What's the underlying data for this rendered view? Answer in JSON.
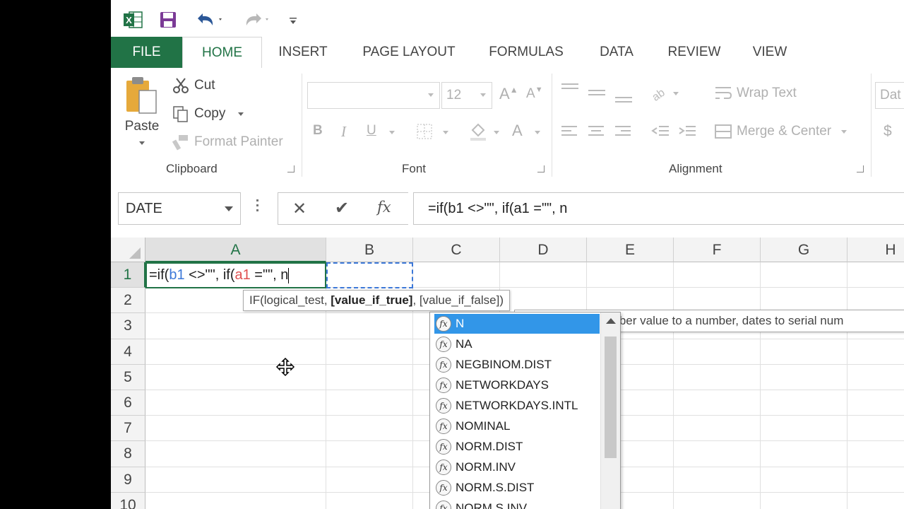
{
  "qat": {
    "app_icon": "excel-logo-icon",
    "save_icon": "save-icon",
    "undo_icon": "undo-icon",
    "redo_icon": "redo-icon",
    "customize_icon": "customize-qat-icon"
  },
  "tabs": [
    "FILE",
    "HOME",
    "INSERT",
    "PAGE LAYOUT",
    "FORMULAS",
    "DATA",
    "REVIEW",
    "VIEW"
  ],
  "clipboard": {
    "paste": "Paste",
    "cut": "Cut",
    "copy": "Copy",
    "format_painter": "Format Painter",
    "label": "Clipboard"
  },
  "font": {
    "name": "",
    "size": "12",
    "label": "Font",
    "bold": "B",
    "italic": "I",
    "underline": "U",
    "grow": "A",
    "shrink": "A",
    "color_letter": "A"
  },
  "alignment": {
    "wrap_text": "Wrap Text",
    "merge_center": "Merge & Center",
    "label": "Alignment"
  },
  "number": {
    "format": "Dat",
    "currency": "$"
  },
  "formula_bar": {
    "name_box": "DATE",
    "cancel": "✕",
    "enter": "✔",
    "fx": "fx",
    "formula": "=if(b1 <>\"\", if(a1 =\"\", n"
  },
  "grid": {
    "columns": [
      "A",
      "B",
      "C",
      "D",
      "E",
      "F",
      "G",
      "H"
    ],
    "rows": [
      "1",
      "2",
      "3",
      "4",
      "5",
      "6",
      "7",
      "8",
      "9",
      "10"
    ],
    "active_cell": "A1",
    "cell_a1": {
      "p1": "=if(",
      "p2": "b1",
      "p3": " <>\"\", if(",
      "p4": "a1",
      "p5": " =\"\", n"
    }
  },
  "tooltip": {
    "start": "IF(logical_test, ",
    "bold": "[value_if_true]",
    "end": ", [value_if_false])"
  },
  "autocomplete": {
    "items": [
      "N",
      "NA",
      "NEGBINOM.DIST",
      "NETWORKDAYS",
      "NETWORKDAYS.INTL",
      "NOMINAL",
      "NORM.DIST",
      "NORM.INV",
      "NORM.S.DIST",
      "NORM.S.INV"
    ],
    "selected": 0,
    "description": "Converts non-number value to a number, dates to serial num"
  },
  "colors": {
    "excel_green": "#217346",
    "ref_blue": "#3c78d8",
    "ref_red": "#e05050",
    "selection_blue": "#3296e8"
  }
}
